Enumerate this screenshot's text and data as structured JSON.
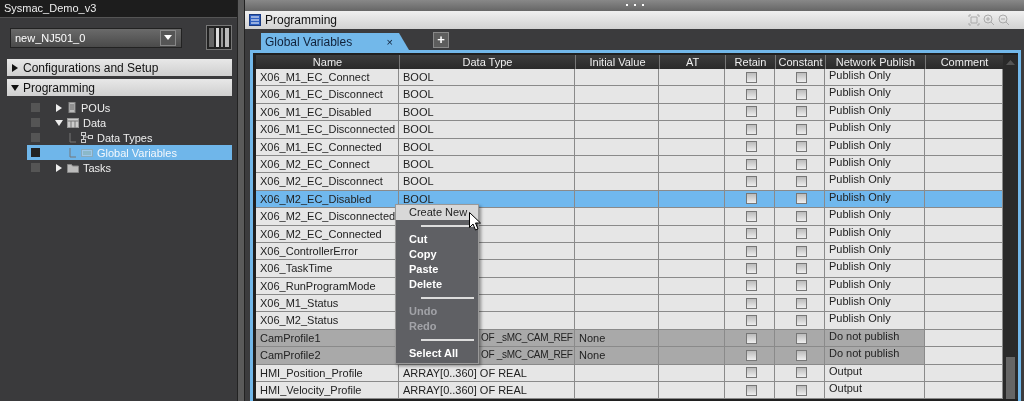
{
  "project": {
    "title": "Sysmac_Demo_v3",
    "device": "new_NJ501_0"
  },
  "sections": [
    {
      "label": "Configurations and Setup",
      "expanded": false
    },
    {
      "label": "Programming",
      "expanded": true,
      "children": [
        {
          "label": "POUs",
          "kind": "program",
          "expanded": false,
          "selected": false
        },
        {
          "label": "Data",
          "kind": "data",
          "expanded": true,
          "selected": false,
          "children": [
            {
              "label": "Data Types",
              "kind": "types",
              "selected": false
            },
            {
              "label": "Global Variables",
              "kind": "variables",
              "selected": true
            }
          ]
        },
        {
          "label": "Tasks",
          "kind": "folder",
          "expanded": false,
          "selected": false
        }
      ]
    }
  ],
  "panel": {
    "title": "Programming"
  },
  "tabs": [
    {
      "label": "Global Variables",
      "close": "×",
      "selected": true
    }
  ],
  "add_tab": "+",
  "table": {
    "columns": [
      "Name",
      "Data Type",
      "Initial Value",
      "AT",
      "Retain",
      "Constant",
      "Network Publish",
      "Comment"
    ],
    "rows": [
      {
        "name": "X06_M1_EC_Connect",
        "data_type": "BOOL",
        "retain": false,
        "constant": false,
        "network_publish": "Publish Only",
        "selected": false,
        "shaded": false
      },
      {
        "name": "X06_M1_EC_Disconnect",
        "data_type": "BOOL",
        "retain": false,
        "constant": false,
        "network_publish": "Publish Only",
        "selected": false,
        "shaded": false
      },
      {
        "name": "X06_M1_EC_Disabled",
        "data_type": "BOOL",
        "retain": false,
        "constant": false,
        "network_publish": "Publish Only",
        "selected": false,
        "shaded": false
      },
      {
        "name": "X06_M1_EC_Disconnected",
        "data_type": "BOOL",
        "retain": false,
        "constant": false,
        "network_publish": "Publish Only",
        "selected": false,
        "shaded": false
      },
      {
        "name": "X06_M1_EC_Connected",
        "data_type": "BOOL",
        "retain": false,
        "constant": false,
        "network_publish": "Publish Only",
        "selected": false,
        "shaded": false
      },
      {
        "name": "X06_M2_EC_Connect",
        "data_type": "BOOL",
        "retain": false,
        "constant": false,
        "network_publish": "Publish Only",
        "selected": false,
        "shaded": false
      },
      {
        "name": "X06_M2_EC_Disconnect",
        "data_type": "BOOL",
        "retain": false,
        "constant": false,
        "network_publish": "Publish Only",
        "selected": false,
        "shaded": false
      },
      {
        "name": "X06_M2_EC_Disabled",
        "data_type": "BOOL",
        "retain": false,
        "constant": false,
        "network_publish": "Publish Only",
        "selected": true,
        "shaded": false
      },
      {
        "name": "X06_M2_EC_Disconnected",
        "retain": false,
        "constant": false,
        "network_publish": "Publish Only",
        "selected": false,
        "shaded": false
      },
      {
        "name": "X06_M2_EC_Connected",
        "retain": false,
        "constant": false,
        "network_publish": "Publish Only",
        "selected": false,
        "shaded": false
      },
      {
        "name": "X06_ControllerError",
        "retain": false,
        "constant": false,
        "network_publish": "Publish Only",
        "selected": false,
        "shaded": false
      },
      {
        "name": "X06_TaskTime",
        "retain": false,
        "constant": false,
        "network_publish": "Publish Only",
        "selected": false,
        "shaded": false
      },
      {
        "name": "X06_RunProgramMode",
        "retain": false,
        "constant": false,
        "network_publish": "Publish Only",
        "selected": false,
        "shaded": false
      },
      {
        "name": "X06_M1_Status",
        "retain": false,
        "constant": false,
        "network_publish": "Publish Only",
        "selected": false,
        "shaded": false
      },
      {
        "name": "X06_M2_Status",
        "retain": false,
        "constant": false,
        "network_publish": "Publish Only",
        "selected": false,
        "shaded": false
      },
      {
        "name": "CamProfile1",
        "data_type": "OF _sMC_CAM_REF",
        "initial_value": "None",
        "retain": false,
        "constant": false,
        "network_publish": "Do not publish",
        "selected": false,
        "shaded": true
      },
      {
        "name": "CamProfile2",
        "data_type": "OF _sMC_CAM_REF",
        "initial_value": "None",
        "retain": false,
        "constant": false,
        "network_publish": "Do not publish",
        "selected": false,
        "shaded": true
      },
      {
        "name": "HMI_Position_Profile",
        "data_type": "ARRAY[0..360] OF REAL",
        "retain": false,
        "constant": false,
        "network_publish": "Output",
        "selected": false,
        "shaded": false
      },
      {
        "name": "HMI_Velocity_Profile",
        "data_type": "ARRAY[0..360] OF REAL",
        "retain": false,
        "constant": false,
        "network_publish": "Output",
        "selected": false,
        "shaded": false
      }
    ]
  },
  "context_menu": [
    {
      "kind": "item",
      "label": "Create New",
      "disabled": false,
      "selected": true
    },
    {
      "kind": "separator"
    },
    {
      "kind": "item",
      "label": "Cut",
      "disabled": false,
      "selected": false
    },
    {
      "kind": "item",
      "label": "Copy",
      "disabled": false,
      "selected": false
    },
    {
      "kind": "item",
      "label": "Paste",
      "disabled": false,
      "selected": false
    },
    {
      "kind": "item",
      "label": "Delete",
      "disabled": false,
      "selected": false
    },
    {
      "kind": "separator"
    },
    {
      "kind": "item",
      "label": "Undo",
      "disabled": true,
      "selected": false
    },
    {
      "kind": "item",
      "label": "Redo",
      "disabled": true,
      "selected": false
    },
    {
      "kind": "separator"
    },
    {
      "kind": "item",
      "label": "Select All",
      "disabled": false,
      "selected": false
    }
  ]
}
